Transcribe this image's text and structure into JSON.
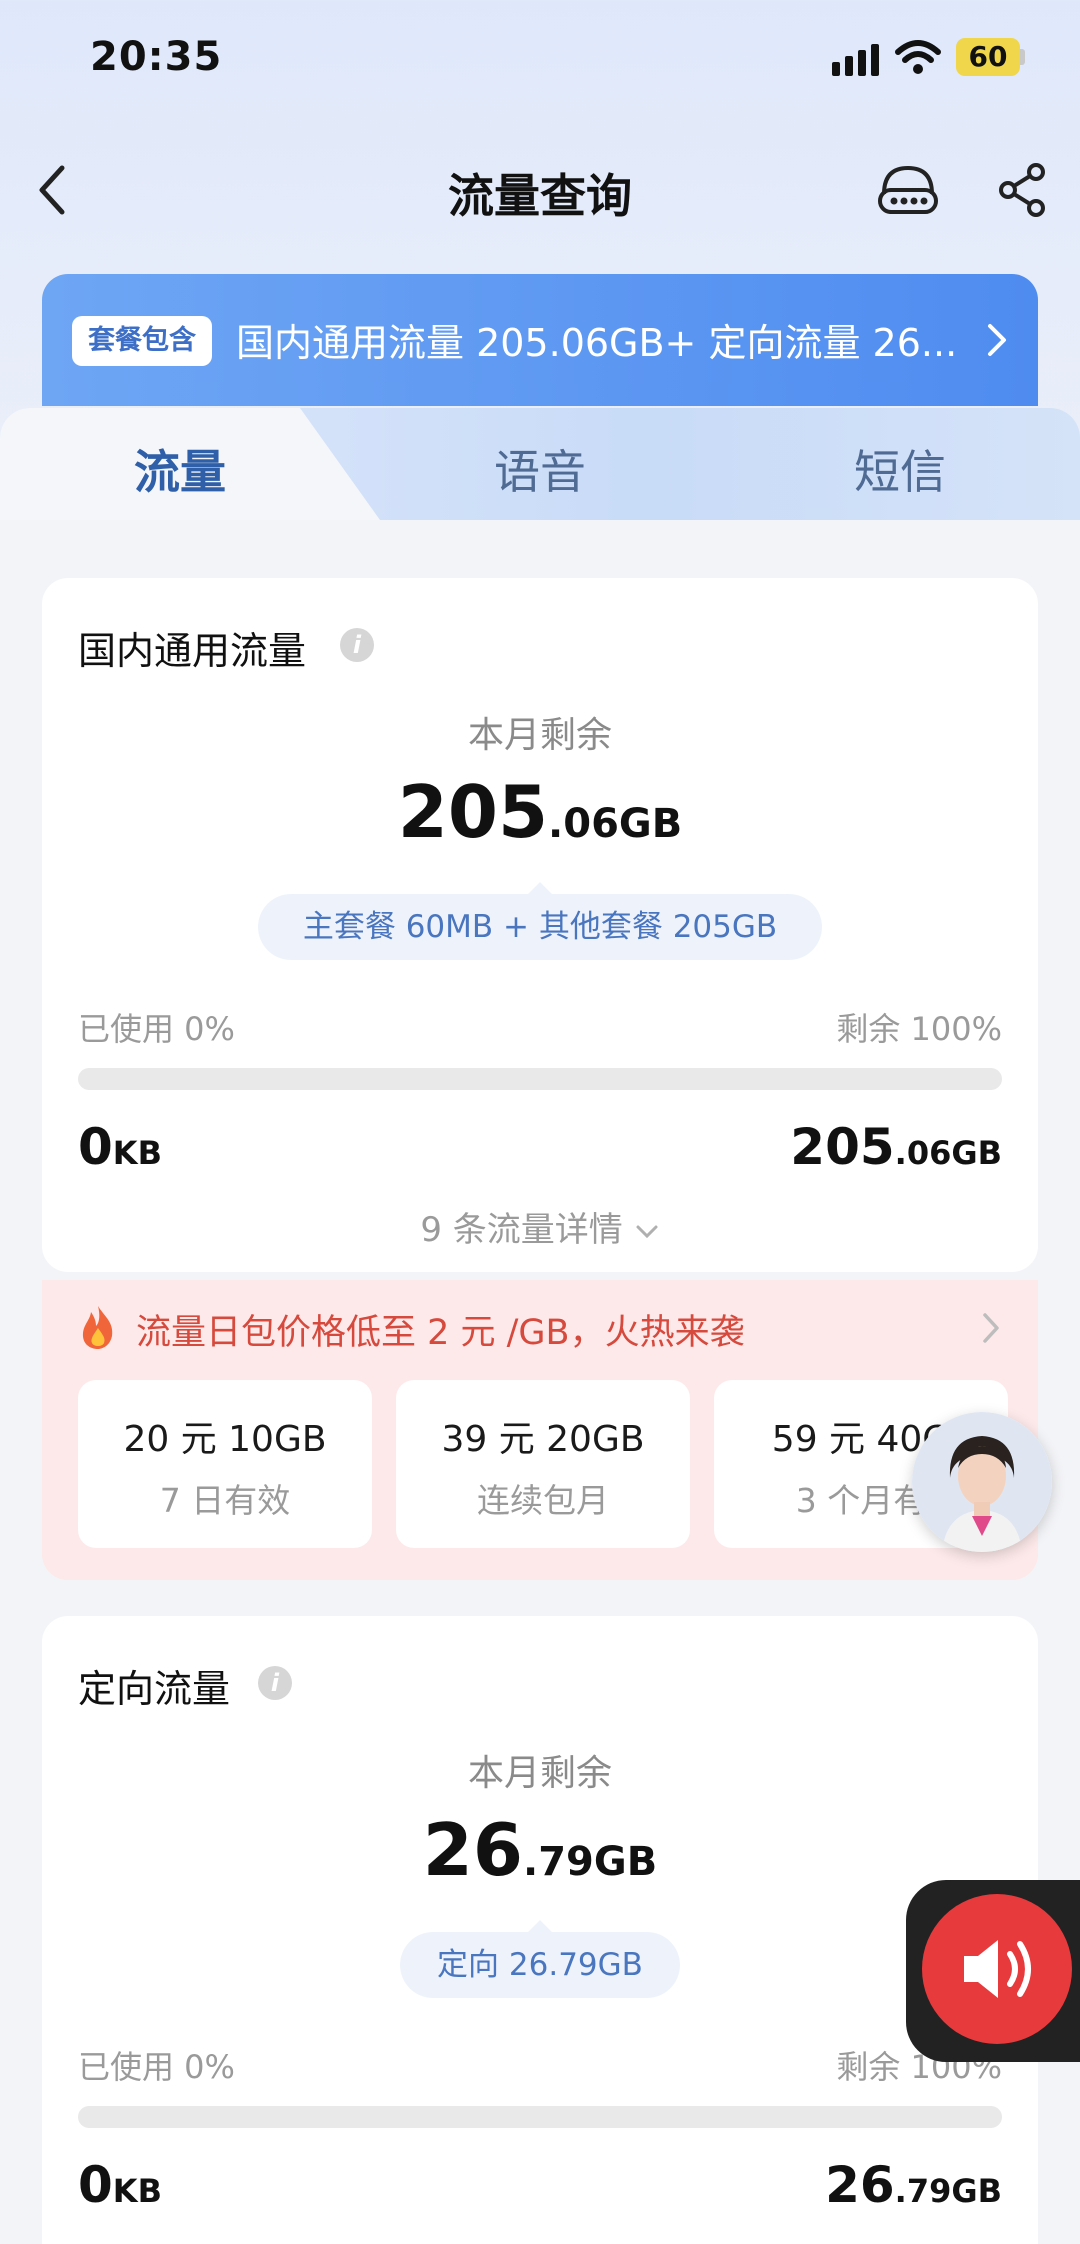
{
  "status_bar": {
    "time": "20:35",
    "battery": "60"
  },
  "nav": {
    "title": "流量查询"
  },
  "banner": {
    "tag": "套餐包含",
    "text": "国内通用流量 205.06GB+ 定向流量 26..."
  },
  "tabs": [
    {
      "label": "流量"
    },
    {
      "label": "语音"
    },
    {
      "label": "短信"
    }
  ],
  "domestic": {
    "title": "国内通用流量",
    "remain_label": "本月剩余",
    "remain_int": "205",
    "remain_dec": ".06GB",
    "breakdown": "主套餐 60MB + 其他套餐 205GB",
    "used_label": "已使用 0%",
    "left_label": "剩余 100%",
    "used_fraction": 0,
    "used_num": "0",
    "used_unit": "KB",
    "total_int": "205",
    "total_dec": ".06GB",
    "detail_link": "9 条流量详情"
  },
  "promo": {
    "text": "流量日包价格低至 2 元 /GB，火热来袭",
    "offers": [
      {
        "title": "20 元 10GB",
        "sub": "7 日有效"
      },
      {
        "title": "39 元 20GB",
        "sub": "连续包月"
      },
      {
        "title": "59 元 40G",
        "sub": "3 个月有"
      }
    ]
  },
  "directional": {
    "title": "定向流量",
    "remain_label": "本月剩余",
    "remain_int": "26",
    "remain_dec": ".79GB",
    "breakdown": "定向 26.79GB",
    "used_label": "已使用 0%",
    "left_label": "剩余 100%",
    "used_fraction": 0,
    "used_num": "0",
    "used_unit": "KB",
    "total_int": "26",
    "total_dec": ".79GB"
  },
  "colors": {
    "accent": "#4f8cf0",
    "promo_red": "#d64a3e",
    "speaker_red": "#e73a3c"
  },
  "icons": {
    "back": "chevron-left-icon",
    "service": "headset-10000-icon",
    "share": "share-icon",
    "fire": "fire-icon",
    "speaker": "speaker-icon"
  }
}
